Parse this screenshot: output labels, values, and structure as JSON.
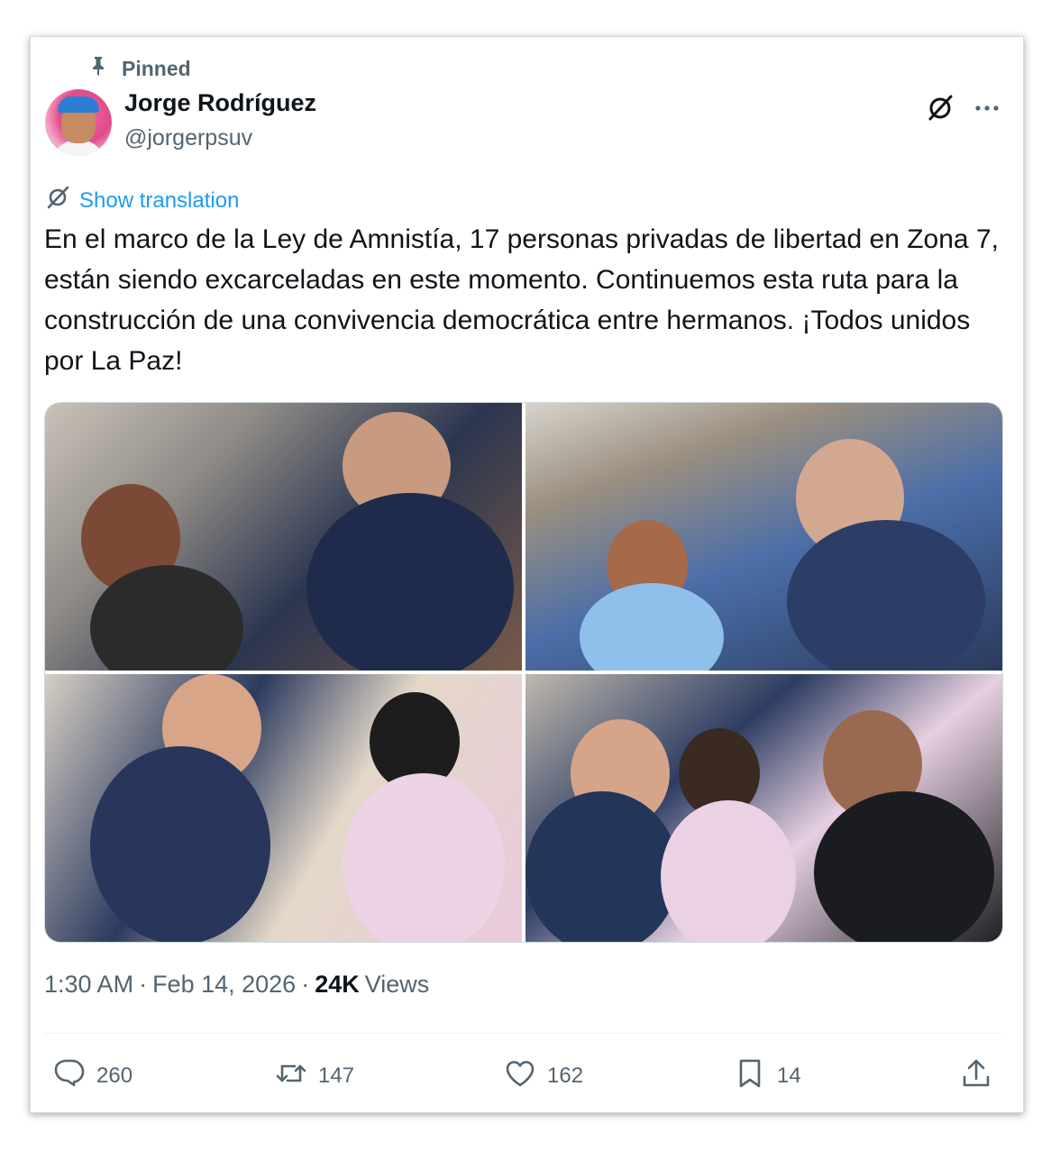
{
  "pinned_label": "Pinned",
  "author": {
    "name": "Jorge Rodríguez",
    "handle": "@jorgerpsuv"
  },
  "translate_label": "Show translation",
  "tweet_text": "En el marco de la Ley de Amnistía, 17 personas privadas de libertad en Zona 7, están siendo excarceladas en este momento. Continuemos esta ruta para la construcción de una convivencia democrática entre hermanos. ¡Todos unidos por La Paz!",
  "media": {
    "count": 4
  },
  "meta": {
    "time": "1:30 AM",
    "sep1": "·",
    "date": "Feb 14, 2026",
    "sep2": "·",
    "views_count": "24K",
    "views_label": "Views"
  },
  "actions": {
    "replies": "260",
    "reposts": "147",
    "likes": "162",
    "bookmarks": "14"
  },
  "icons": {
    "pin": "pin-icon",
    "grok": "grok-icon",
    "more": "more-icon",
    "translate": "translate-icon",
    "reply": "reply-icon",
    "repost": "repost-icon",
    "like": "heart-icon",
    "bookmark": "bookmark-icon",
    "share": "share-icon"
  },
  "colors": {
    "accent": "#1d9bf0",
    "secondary_text": "#536471",
    "primary_text": "#0f1419"
  }
}
